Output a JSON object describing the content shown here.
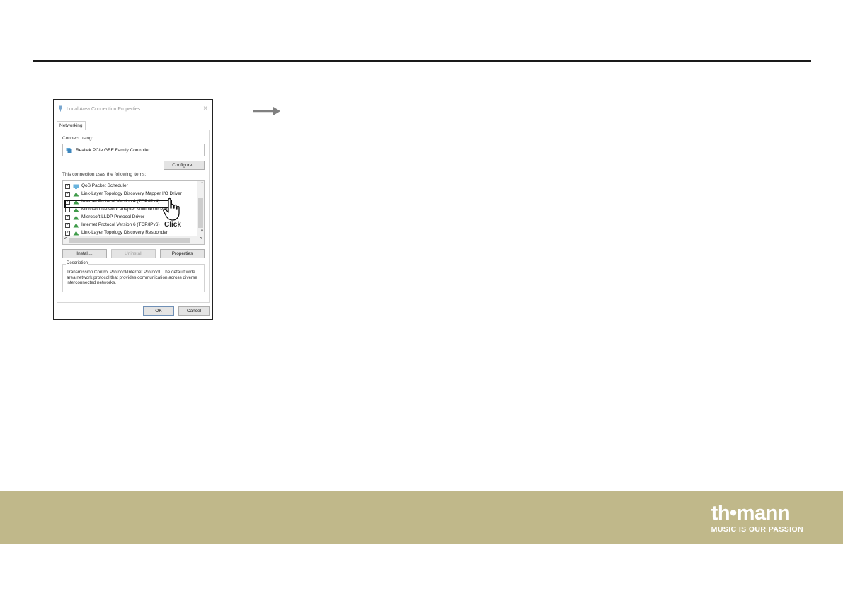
{
  "dialog": {
    "title": "Local Area Connection Properties",
    "close_glyph": "×",
    "tab_label": "Networking",
    "connect_using_label": "Connect using:",
    "adapter_name": "Realtek PCIe GBE Family Controller",
    "configure_label": "Configure...",
    "items_label": "This connection uses the following items:",
    "items": [
      {
        "checked": true,
        "icon": "qos-icon",
        "label": "QoS Packet Scheduler"
      },
      {
        "checked": true,
        "icon": "protocol-icon",
        "label": "Link-Layer Topology Discovery Mapper I/O Driver"
      },
      {
        "checked": true,
        "icon": "protocol-icon",
        "label": "Internet Protocol Version 4 (TCP/IPv4)"
      },
      {
        "checked": false,
        "icon": "protocol-icon",
        "label": "Microsoft Network Adapter Multiplexor Protocol"
      },
      {
        "checked": true,
        "icon": "protocol-icon",
        "label": "Microsoft LLDP Protocol Driver"
      },
      {
        "checked": true,
        "icon": "protocol-icon",
        "label": "Internet Protocol Version 6 (TCP/IPv6)"
      },
      {
        "checked": true,
        "icon": "protocol-icon",
        "label": "Link-Layer Topology Discovery Responder"
      }
    ],
    "install_label": "Install...",
    "uninstall_label": "Uninstall",
    "properties_label": "Properties",
    "description_heading": "Description",
    "description_text": "Transmission Control Protocol/Internet Protocol. The default wide area network protocol that provides communication across diverse interconnected networks.",
    "ok_label": "OK",
    "cancel_label": "Cancel",
    "click_annotation": "Click"
  },
  "footer": {
    "brand_logo": "th•mann",
    "brand_tagline": "MUSIC IS OUR PASSION",
    "color": "#c0b88a"
  }
}
